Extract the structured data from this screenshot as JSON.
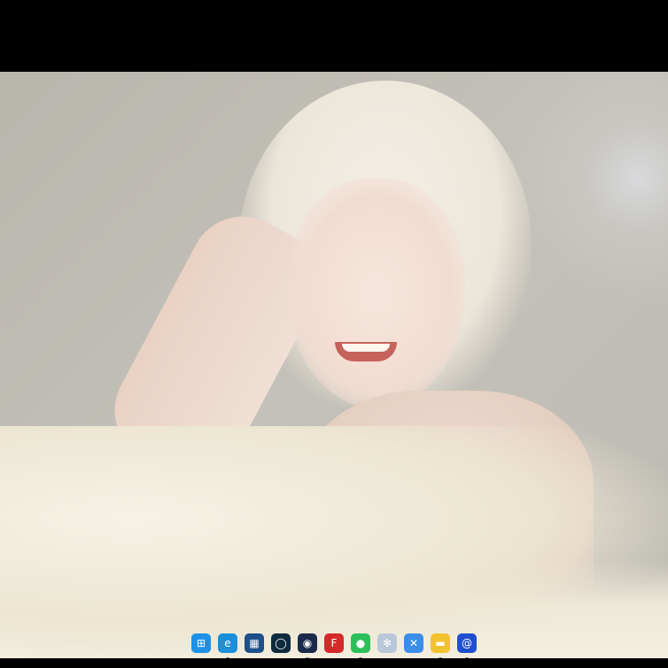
{
  "desktop": {
    "wallpaper": "anime-girl-white-hair-wallpaper"
  },
  "taskbar": {
    "icons": [
      {
        "name": "start-icon",
        "glyph": "⊞",
        "color": "#1e90e8",
        "running": false
      },
      {
        "name": "edge-icon",
        "glyph": "e",
        "color": "#1b8fd8",
        "running": true
      },
      {
        "name": "store-icon",
        "glyph": "▦",
        "color": "#1d4f8a",
        "running": false
      },
      {
        "name": "app-circle-icon",
        "glyph": "◯",
        "color": "#0f2a3d",
        "running": false
      },
      {
        "name": "steam-icon",
        "glyph": "◉",
        "color": "#1a2a4a",
        "running": true
      },
      {
        "name": "f-app-icon",
        "glyph": "F",
        "color": "#d42a2a",
        "running": false
      },
      {
        "name": "wechat-icon",
        "glyph": "●",
        "color": "#2dc05a",
        "running": true
      },
      {
        "name": "pinwheel-icon",
        "glyph": "✻",
        "color": "#b8c8d8",
        "running": false
      },
      {
        "name": "bird-app-icon",
        "glyph": "✕",
        "color": "#3a8ee8",
        "running": false
      },
      {
        "name": "file-explorer-icon",
        "glyph": "▬",
        "color": "#f2c230",
        "running": true
      },
      {
        "name": "blue-app-icon",
        "glyph": "@",
        "color": "#1e4fd0",
        "running": true
      }
    ]
  }
}
